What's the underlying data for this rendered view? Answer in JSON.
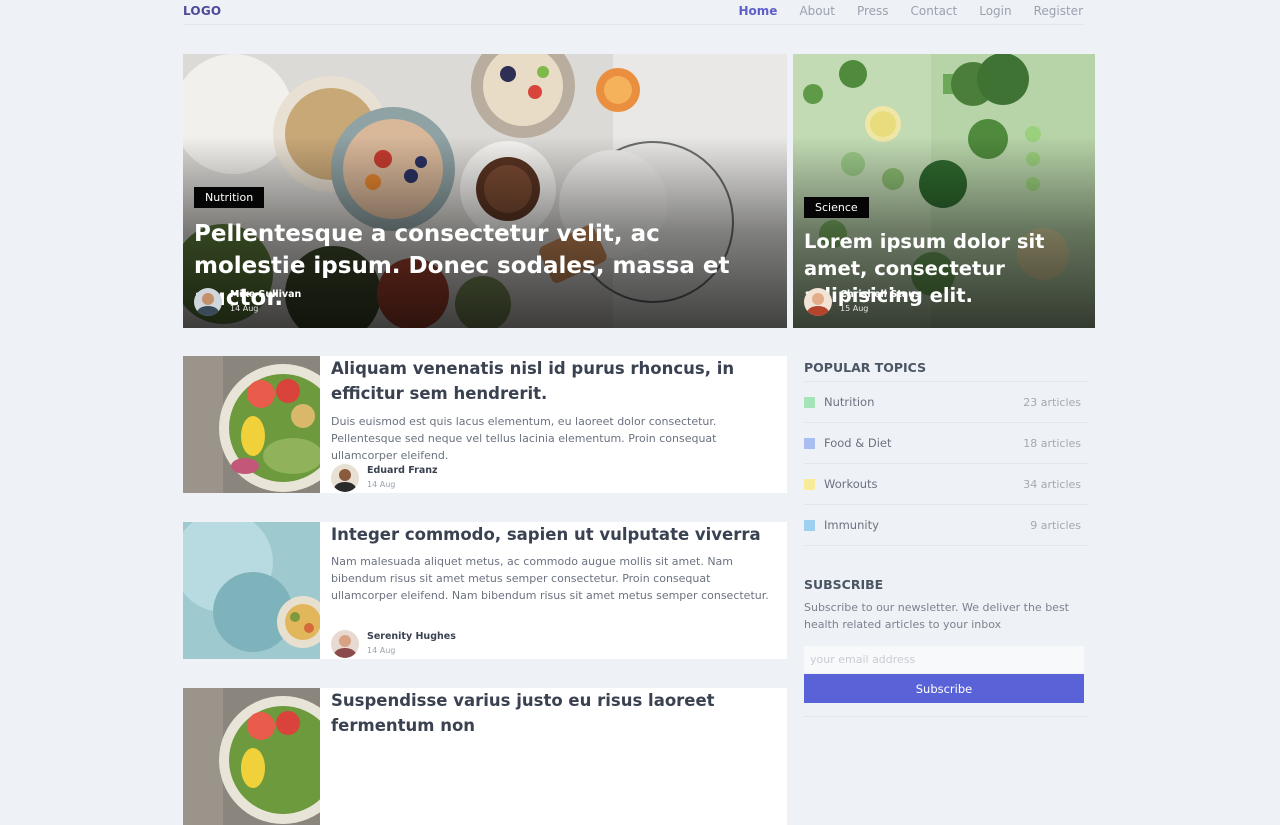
{
  "header": {
    "logo": "LOGO",
    "nav": [
      {
        "label": "Home",
        "active": true
      },
      {
        "label": "About"
      },
      {
        "label": "Press"
      },
      {
        "label": "Contact"
      },
      {
        "label": "Login"
      },
      {
        "label": "Register"
      }
    ]
  },
  "featured": [
    {
      "tag": "Nutrition",
      "title": "Pellentesque a consectetur velit, ac molestie ipsum. Donec sodales, massa et auctor.",
      "author": "Mike Sullivan",
      "date": "14 Aug"
    },
    {
      "tag": "Science",
      "title": "Lorem ipsum dolor sit amet, consectetur adipisicing elit.",
      "author": "Chrishell Staus",
      "date": "15 Aug"
    }
  ],
  "articles": [
    {
      "title": "Aliquam venenatis nisl id purus rhoncus, in efficitur sem hendrerit.",
      "excerpt": "Duis euismod est quis lacus elementum, eu laoreet dolor consectetur. Pellentesque sed neque vel tellus lacinia elementum. Proin consequat ullamcorper eleifend.",
      "author": "Eduard Franz",
      "date": "14 Aug"
    },
    {
      "title": "Integer commodo, sapien ut vulputate viverra",
      "excerpt": "Nam malesuada aliquet metus, ac commodo augue mollis sit amet. Nam bibendum risus sit amet metus semper consectetur. Proin consequat ullamcorper eleifend. Nam bibendum risus sit amet metus semper consectetur.",
      "author": "Serenity Hughes",
      "date": "14 Aug"
    },
    {
      "title": "Suspendisse varius justo eu risus laoreet fermentum non"
    }
  ],
  "sidebar": {
    "topics_heading": "POPULAR TOPICS",
    "topics": [
      {
        "name": "Nutrition",
        "count": "23 articles",
        "color": "#a5e3b8"
      },
      {
        "name": "Food & Diet",
        "count": "18 articles",
        "color": "#a8bdf0"
      },
      {
        "name": "Workouts",
        "count": "34 articles",
        "color": "#f6ec9a"
      },
      {
        "name": "Immunity",
        "count": "9 articles",
        "color": "#9cd0ee"
      }
    ],
    "subscribe_heading": "SUBSCRIBE",
    "subscribe_text": "Subscribe to our newsletter. We deliver the best health related articles to your inbox",
    "email_placeholder": "your email address",
    "subscribe_button": "Subscribe"
  }
}
